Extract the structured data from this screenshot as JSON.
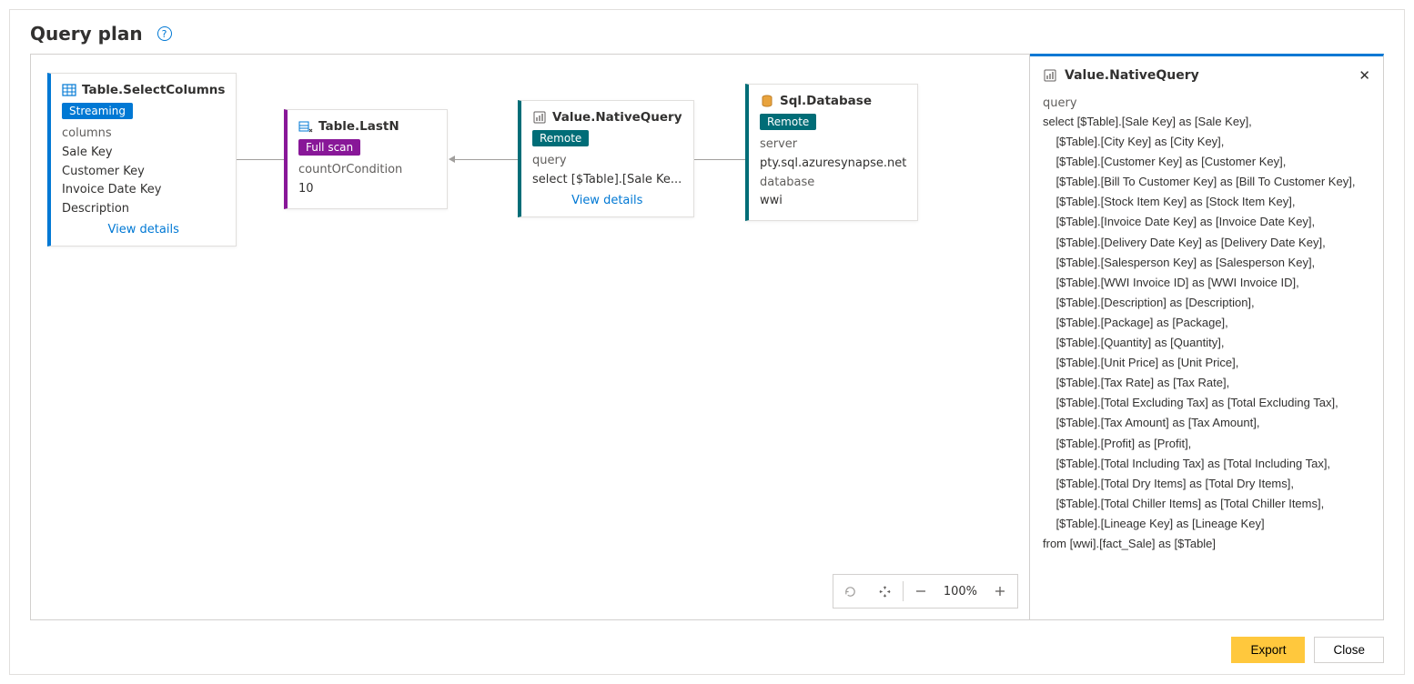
{
  "header": {
    "title": "Query plan"
  },
  "nodes": {
    "n1": {
      "title": "Table.SelectColumns",
      "badge": "Streaming",
      "label": "columns",
      "values": [
        "Sale Key",
        "Customer Key",
        "Invoice Date Key",
        "Description"
      ],
      "view_details": "View details",
      "accent": "#0078d4"
    },
    "n2": {
      "title": "Table.LastN",
      "badge": "Full scan",
      "label": "countOrCondition",
      "value": "10",
      "accent": "#881798"
    },
    "n3": {
      "title": "Value.NativeQuery",
      "badge": "Remote",
      "label": "query",
      "value": "select [$Table].[Sale Ke...",
      "view_details": "View details",
      "accent": "#006d77"
    },
    "n4": {
      "title": "Sql.Database",
      "badge": "Remote",
      "label1": "server",
      "value1": "pty.sql.azuresynapse.net",
      "label2": "database",
      "value2": "wwi",
      "accent": "#006d77"
    }
  },
  "details": {
    "title": "Value.NativeQuery",
    "section_label": "query",
    "sql": "select [$Table].[Sale Key] as [Sale Key],\n    [$Table].[City Key] as [City Key],\n    [$Table].[Customer Key] as [Customer Key],\n    [$Table].[Bill To Customer Key] as [Bill To Customer Key],\n    [$Table].[Stock Item Key] as [Stock Item Key],\n    [$Table].[Invoice Date Key] as [Invoice Date Key],\n    [$Table].[Delivery Date Key] as [Delivery Date Key],\n    [$Table].[Salesperson Key] as [Salesperson Key],\n    [$Table].[WWI Invoice ID] as [WWI Invoice ID],\n    [$Table].[Description] as [Description],\n    [$Table].[Package] as [Package],\n    [$Table].[Quantity] as [Quantity],\n    [$Table].[Unit Price] as [Unit Price],\n    [$Table].[Tax Rate] as [Tax Rate],\n    [$Table].[Total Excluding Tax] as [Total Excluding Tax],\n    [$Table].[Tax Amount] as [Tax Amount],\n    [$Table].[Profit] as [Profit],\n    [$Table].[Total Including Tax] as [Total Including Tax],\n    [$Table].[Total Dry Items] as [Total Dry Items],\n    [$Table].[Total Chiller Items] as [Total Chiller Items],\n    [$Table].[Lineage Key] as [Lineage Key]\nfrom [wwi].[fact_Sale] as [$Table]"
  },
  "toolbar": {
    "zoom": "100%"
  },
  "footer": {
    "export": "Export",
    "close": "Close"
  }
}
